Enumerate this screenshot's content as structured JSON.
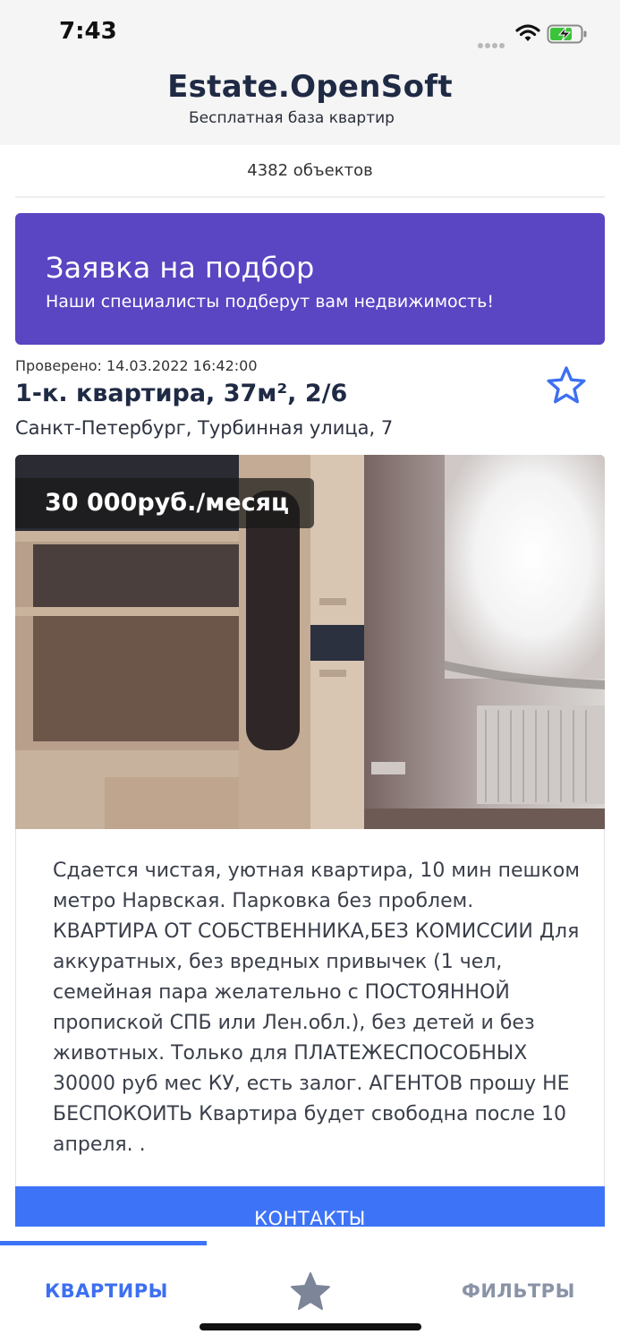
{
  "status_bar": {
    "time": "7:43",
    "icons": [
      "signal-dots-icon",
      "wifi-icon",
      "battery-charging-icon"
    ]
  },
  "header": {
    "title": "Estate.OpenSoft",
    "subtitle": "Бесплатная база квартир"
  },
  "summary": {
    "count_text": "4382 объектов"
  },
  "promo": {
    "title": "Заявка на подбор",
    "text": "Наши специалисты подберут вам недвижимость!",
    "color": "#5a45c2"
  },
  "listing": {
    "checked": "Проверено: 14.03.2022 16:42:00",
    "title": "1-к. квартира, 37м², 2/6",
    "address": "Санкт-Петербург, Турбинная улица, 7",
    "price": "30 000руб./месяц",
    "favorite_icon": "star-outline-icon",
    "description": "Сдается чистая, уютная квартира, 10 мин пешком метро Нарвская. Парковка без проблем. КВАРТИРА ОТ СОБСТВЕННИКА,БЕЗ КОМИССИИ Для аккуратных, без вредных привычек (1 чел, семейная пара желательно с ПОСТОЯННОЙ пропиской СПБ или Лен.обл.), без детей и без животных. Только для ПЛАТЕЖЕСПОСОБНЫХ 30000 руб мес КУ, есть залог. АГЕНТОВ прошу НЕ БЕСПОКОИТЬ Квартира будет свободна после 10 апреля. .",
    "contacts_label": "КОНТАКТЫ"
  },
  "tabbar": {
    "apartments": "КВАРТИРЫ",
    "favorites_icon": "star-filled-icon",
    "filters": "ФИЛЬТРЫ",
    "active": "КВАРТИРЫ"
  },
  "colors": {
    "accent": "#3d73f7",
    "active_tab": "#3d6ff0",
    "inactive_tab": "#8a93a7",
    "title": "#1f2a44"
  }
}
